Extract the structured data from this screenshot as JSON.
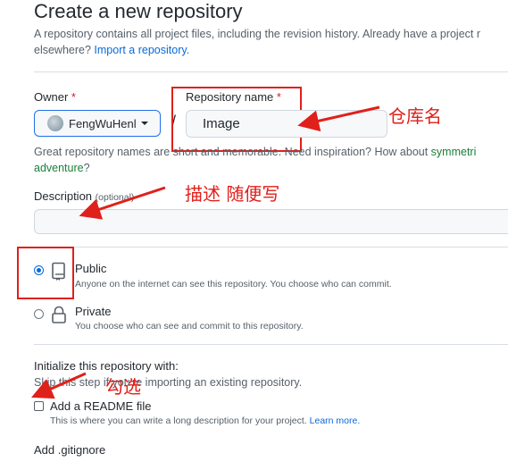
{
  "page": {
    "title": "Create a new repository",
    "intro_line1": "A repository contains all project files, including the revision history. Already have a project r",
    "intro_line2_prefix": "elsewhere? ",
    "intro_import_link": "Import a repository."
  },
  "owner": {
    "label": "Owner",
    "required_mark": "*",
    "value": "FengWuHenl"
  },
  "repository": {
    "label": "Repository name",
    "required_mark": "*",
    "separator": "/",
    "value": "Image",
    "hint_prefix": "Great repository names are short and memorable. Need inspiration? How about ",
    "hint_suggestion_1": "symmetri",
    "hint_suggestion_2": "adventure",
    "hint_suffix": "?"
  },
  "description": {
    "label": "Description",
    "optional_text": "(optional)",
    "value": ""
  },
  "visibility": {
    "public_title": "Public",
    "public_desc": "Anyone on the internet can see this repository. You choose who can commit.",
    "private_title": "Private",
    "private_desc": "You choose who can see and commit to this repository.",
    "selected": "public"
  },
  "initialize": {
    "heading": "Initialize this repository with:",
    "skip_text": "Skip this step if you're importing an existing repository.",
    "readme_label": "Add a README file",
    "readme_desc": "This is where you can write a long description for your project.",
    "readme_learn_more": "Learn more.",
    "readme_checked": false,
    "gitignore_label": "Add .gitignore"
  },
  "annotations": {
    "repo_name": "仓库名",
    "description": "描述 随便写",
    "check": "勾选"
  },
  "colors": {
    "annotation_red": "#e0201b",
    "link_blue": "#0969da",
    "suggestion_green": "#1a7f37"
  }
}
